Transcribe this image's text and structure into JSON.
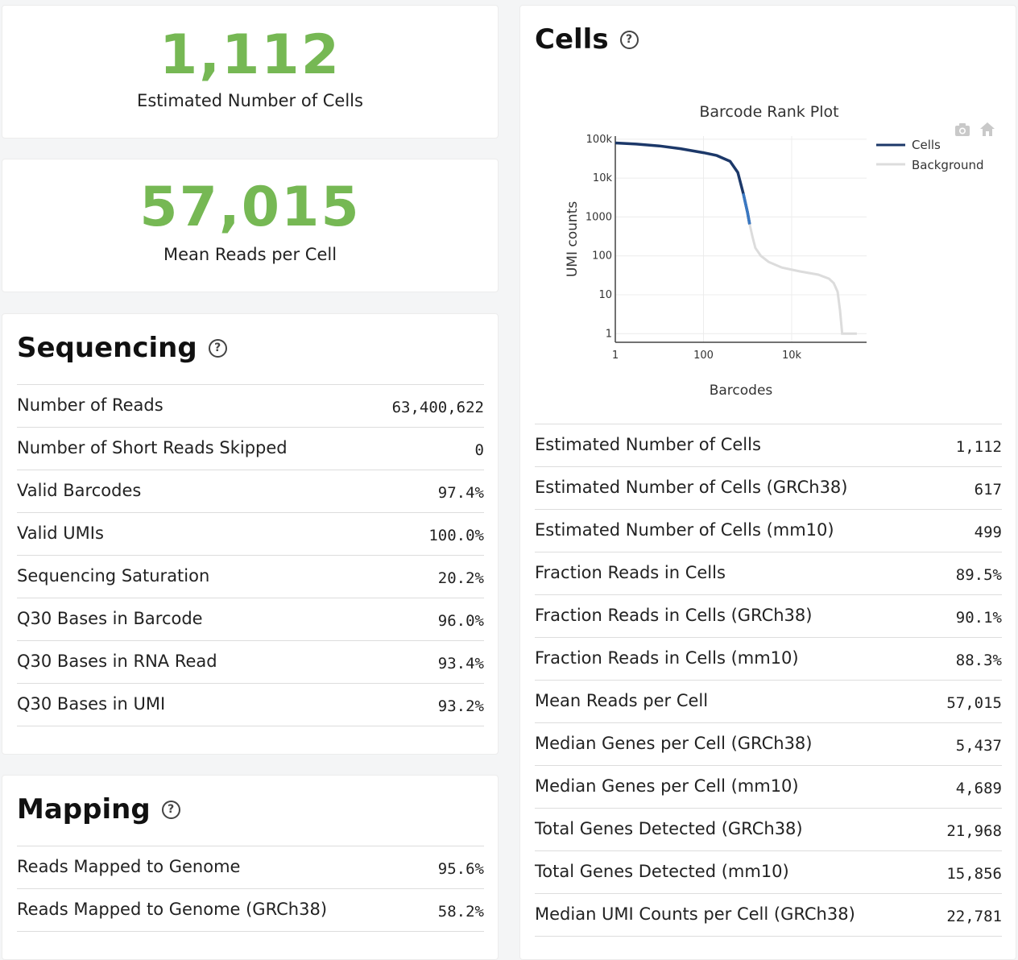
{
  "summary": {
    "cells_value": "1,112",
    "cells_label": "Estimated Number of Cells",
    "reads_value": "57,015",
    "reads_label": "Mean Reads per Cell"
  },
  "sequencing": {
    "title": "Sequencing",
    "rows": [
      {
        "label": "Number of Reads",
        "value": "63,400,622"
      },
      {
        "label": "Number of Short Reads Skipped",
        "value": "0"
      },
      {
        "label": "Valid Barcodes",
        "value": "97.4%"
      },
      {
        "label": "Valid UMIs",
        "value": "100.0%"
      },
      {
        "label": "Sequencing Saturation",
        "value": "20.2%"
      },
      {
        "label": "Q30 Bases in Barcode",
        "value": "96.0%"
      },
      {
        "label": "Q30 Bases in RNA Read",
        "value": "93.4%"
      },
      {
        "label": "Q30 Bases in UMI",
        "value": "93.2%"
      }
    ]
  },
  "mapping": {
    "title": "Mapping",
    "rows": [
      {
        "label": "Reads Mapped to Genome",
        "value": "95.6%"
      },
      {
        "label": "Reads Mapped to Genome (GRCh38)",
        "value": "58.2%"
      }
    ]
  },
  "cells": {
    "title": "Cells",
    "rows": [
      {
        "label": "Estimated Number of Cells",
        "value": "1,112"
      },
      {
        "label": "Estimated Number of Cells (GRCh38)",
        "value": "617"
      },
      {
        "label": "Estimated Number of Cells (mm10)",
        "value": "499"
      },
      {
        "label": "Fraction Reads in Cells",
        "value": "89.5%"
      },
      {
        "label": "Fraction Reads in Cells (GRCh38)",
        "value": "90.1%"
      },
      {
        "label": "Fraction Reads in Cells (mm10)",
        "value": "88.3%"
      },
      {
        "label": "Mean Reads per Cell",
        "value": "57,015"
      },
      {
        "label": "Median Genes per Cell (GRCh38)",
        "value": "5,437"
      },
      {
        "label": "Median Genes per Cell (mm10)",
        "value": "4,689"
      },
      {
        "label": "Total Genes Detected (GRCh38)",
        "value": "21,968"
      },
      {
        "label": "Total Genes Detected (mm10)",
        "value": "15,856"
      },
      {
        "label": "Median UMI Counts per Cell (GRCh38)",
        "value": "22,781"
      }
    ]
  },
  "icons": {
    "help": "question-circle-icon",
    "camera": "camera-icon",
    "home": "home-icon"
  },
  "colors": {
    "accent_green": "#76b854",
    "cells_line": "#1c3869",
    "cells_line_tail": "#3a78c2",
    "background_line": "#dcdcdc"
  },
  "chart_data": {
    "type": "line",
    "title": "Barcode Rank Plot",
    "xlabel": "Barcodes",
    "ylabel": "UMI counts",
    "x_scale": "log",
    "y_scale": "log",
    "xlim": [
      1,
      500000
    ],
    "ylim": [
      0.6,
      120000
    ],
    "x_ticks": [
      "1",
      "100",
      "10k"
    ],
    "y_ticks": [
      "1",
      "10",
      "100",
      "1000",
      "10k",
      "100k"
    ],
    "legend": [
      "Cells",
      "Background"
    ],
    "legend_position": "top-right",
    "grid": true,
    "series": [
      {
        "name": "Cells",
        "x": [
          1,
          3,
          10,
          30,
          100,
          200,
          400,
          600,
          800,
          1000,
          1112
        ],
        "y": [
          80000,
          75000,
          67000,
          57000,
          45000,
          38000,
          27000,
          14000,
          4000,
          1300,
          650
        ]
      },
      {
        "name": "Background",
        "x": [
          1112,
          1300,
          1500,
          2000,
          3000,
          6000,
          15000,
          40000,
          70000,
          90000,
          110000,
          125000,
          140000,
          180000,
          300000
        ],
        "y": [
          650,
          300,
          160,
          100,
          70,
          50,
          40,
          33,
          26,
          20,
          12,
          4,
          1,
          1,
          1
        ]
      }
    ]
  }
}
